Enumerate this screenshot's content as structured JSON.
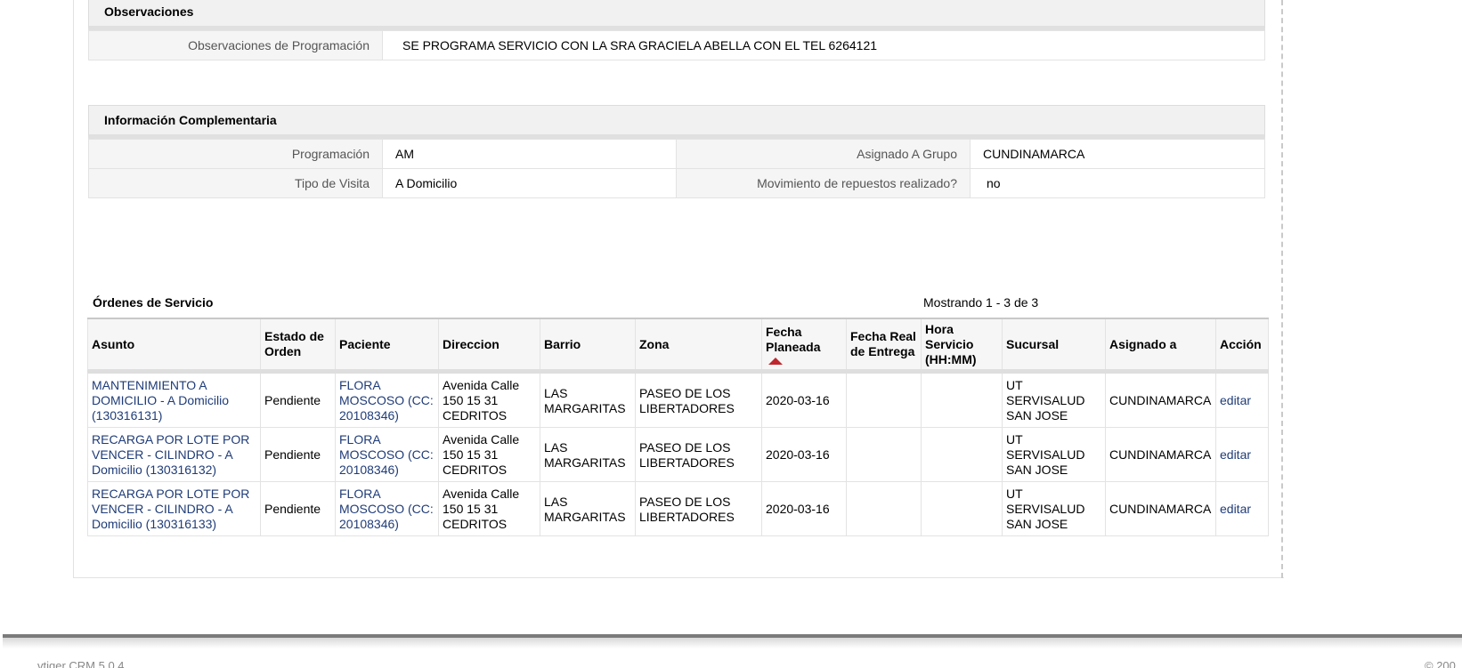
{
  "observaciones": {
    "header": "Observaciones",
    "label": "Observaciones de Programación",
    "value": "SE PROGRAMA SERVICIO CON LA SRA GRACIELA ABELLA CON EL TEL 6264121"
  },
  "info": {
    "header": "Información Complementaria",
    "programacion_label": "Programación",
    "programacion_value": "AM",
    "grupo_label": "Asignado A Grupo",
    "grupo_value": "CUNDINAMARCA",
    "visita_label": "Tipo de Visita",
    "visita_value": "A Domicilio",
    "repuestos_label": "Movimiento de repuestos realizado?",
    "repuestos_value": "no"
  },
  "orders": {
    "title": "Órdenes de Servicio",
    "count": "Mostrando 1 - 3 de 3",
    "columns": {
      "asunto": "Asunto",
      "estado": "Estado de Orden",
      "paciente": "Paciente",
      "direccion": "Direccion",
      "barrio": "Barrio",
      "zona": "Zona",
      "fecha_planeada": "Fecha Planeada",
      "fecha_real": "Fecha Real de Entrega",
      "hora": "Hora Servicio (HH:MM)",
      "sucursal": "Sucursal",
      "asignado": "Asignado a",
      "accion": "Acción"
    },
    "rows": [
      {
        "asunto": "MANTENIMIENTO A DOMICILIO - A Domicilio (130316131)",
        "estado": "Pendiente",
        "paciente": "FLORA MOSCOSO (CC: 20108346)",
        "direccion": "Avenida Calle 150 15 31 CEDRITOS",
        "barrio": "LAS MARGARITAS",
        "zona": "PASEO DE LOS LIBERTADORES",
        "fecha_planeada": "2020-03-16",
        "fecha_real": "",
        "hora": "",
        "sucursal": "UT SERVISALUD SAN JOSE",
        "asignado": "CUNDINAMARCA",
        "accion": "editar"
      },
      {
        "asunto": "RECARGA POR LOTE POR VENCER - CILINDRO - A Domicilio (130316132)",
        "estado": "Pendiente",
        "paciente": "FLORA MOSCOSO (CC: 20108346)",
        "direccion": "Avenida Calle 150 15 31 CEDRITOS",
        "barrio": "LAS MARGARITAS",
        "zona": "PASEO DE LOS LIBERTADORES",
        "fecha_planeada": "2020-03-16",
        "fecha_real": "",
        "hora": "",
        "sucursal": "UT SERVISALUD SAN JOSE",
        "asignado": "CUNDINAMARCA",
        "accion": "editar"
      },
      {
        "asunto": "RECARGA POR LOTE POR VENCER - CILINDRO - A Domicilio (130316133)",
        "estado": "Pendiente",
        "paciente": "FLORA MOSCOSO (CC: 20108346)",
        "direccion": "Avenida Calle 150 15 31 CEDRITOS",
        "barrio": "LAS MARGARITAS",
        "zona": "PASEO DE LOS LIBERTADORES",
        "fecha_planeada": "2020-03-16",
        "fecha_real": "",
        "hora": "",
        "sucursal": "UT SERVISALUD SAN JOSE",
        "asignado": "CUNDINAMARCA",
        "accion": "editar"
      }
    ]
  },
  "footer": {
    "left": "vtiger CRM 5.0.4",
    "right": "© 200"
  }
}
